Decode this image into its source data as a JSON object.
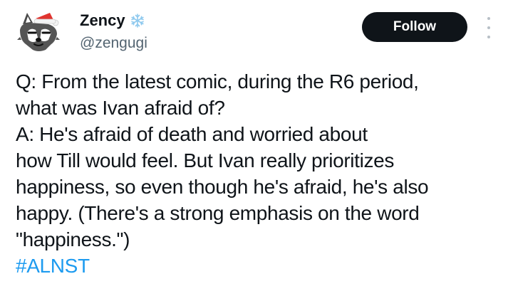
{
  "user": {
    "display_name": "Zency",
    "handle": "@zengugi",
    "badge_icon": "snowflake-icon",
    "avatar_icon": "wolf-with-santa-hat-avatar"
  },
  "actions": {
    "follow_label": "Follow",
    "more_icon": "more-vertical-icon"
  },
  "tweet": {
    "lines": [
      "Q: From the latest comic, during the R6 period,",
      "what was Ivan afraid of?",
      "A: He's afraid of death and worried about",
      "how Till would feel. But Ivan really prioritizes",
      "happiness, so even though he's afraid, he's also",
      "happy. (There's a strong emphasis on the word",
      "\"happiness.\")"
    ],
    "hashtag": "#ALNST"
  },
  "colors": {
    "text": "#0f1419",
    "secondary": "#536471",
    "link": "#1d9bf0",
    "button_bg": "#0f1419",
    "button_text": "#ffffff"
  }
}
